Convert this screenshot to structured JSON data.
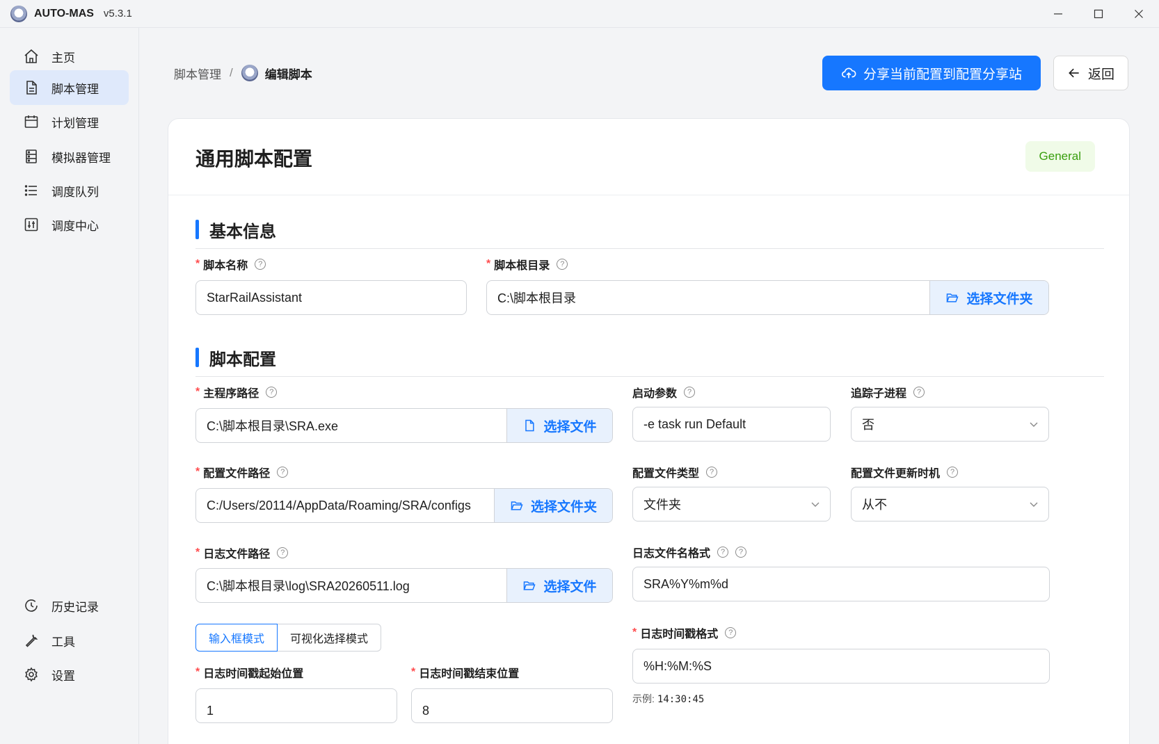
{
  "window": {
    "app_name": "AUTO-MAS",
    "version": "v5.3.1",
    "minimize_icon": "minimize-icon",
    "maximize_icon": "maximize-icon",
    "close_icon": "close-icon"
  },
  "sidebar": {
    "items": [
      {
        "label": "主页",
        "icon": "home-icon"
      },
      {
        "label": "脚本管理",
        "icon": "document-icon",
        "active": true
      },
      {
        "label": "计划管理",
        "icon": "calendar-icon"
      },
      {
        "label": "模拟器管理",
        "icon": "database-icon"
      },
      {
        "label": "调度队列",
        "icon": "list-icon"
      },
      {
        "label": "调度中心",
        "icon": "sliders-icon"
      }
    ],
    "bottom_items": [
      {
        "label": "历史记录",
        "icon": "history-icon"
      },
      {
        "label": "工具",
        "icon": "wrench-icon"
      },
      {
        "label": "设置",
        "icon": "gear-icon"
      }
    ]
  },
  "header": {
    "breadcrumb_parent": "脚本管理",
    "breadcrumb_separator": "/",
    "breadcrumb_current": "编辑脚本",
    "share_button": "分享当前配置到配置分享站",
    "back_button": "返回"
  },
  "card": {
    "title": "通用脚本配置",
    "tag": "General"
  },
  "basic": {
    "section_title": "基本信息",
    "script_name_label": "脚本名称",
    "script_name_value": "StarRailAssistant",
    "root_dir_label": "脚本根目录",
    "root_dir_value": "C:\\脚本根目录",
    "root_dir_button": "选择文件夹"
  },
  "config": {
    "section_title": "脚本配置",
    "exe_path_label": "主程序路径",
    "exe_path_value": "C:\\脚本根目录\\SRA.exe",
    "exe_path_button": "选择文件",
    "launch_args_label": "启动参数",
    "launch_args_value": "-e task run Default",
    "track_child_label": "追踪子进程",
    "track_child_value": "否",
    "config_path_label": "配置文件路径",
    "config_path_value": "C:/Users/20114/AppData/Roaming/SRA/configs",
    "config_path_button": "选择文件夹",
    "config_type_label": "配置文件类型",
    "config_type_value": "文件夹",
    "config_update_label": "配置文件更新时机",
    "config_update_value": "从不",
    "log_path_label": "日志文件路径",
    "log_path_value": "C:\\脚本根目录\\log\\SRA20260511.log",
    "log_path_button": "选择文件",
    "log_name_format_label": "日志文件名格式",
    "log_name_format_value": "SRA%Y%m%d",
    "mode_input": "输入框模式",
    "mode_visual": "可视化选择模式",
    "ts_format_label": "日志时间戳格式",
    "ts_format_value": "%H:%M:%S",
    "example_label": "示例:",
    "example_value": "14:30:45",
    "ts_start_label": "日志时间戳起始位置",
    "ts_start_value": "1",
    "ts_end_label": "日志时间戳结束位置",
    "ts_end_value": "8"
  }
}
